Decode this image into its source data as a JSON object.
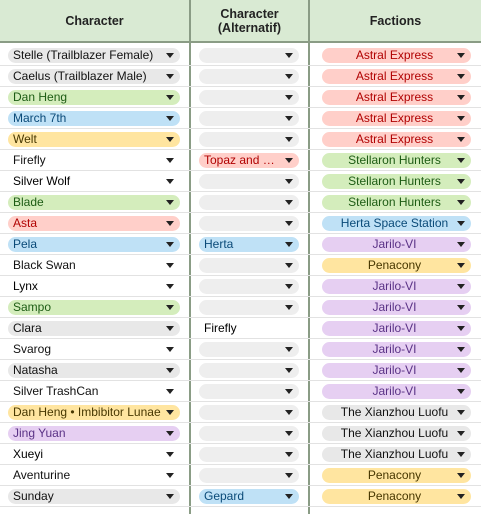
{
  "headers": {
    "character": "Character",
    "character_alt_line1": "Character",
    "character_alt_line2": "(Alternatif)",
    "factions": "Factions"
  },
  "colors": {
    "header_bg": "#d9ead3",
    "grey": "#e8e8e8",
    "green": "#d4edbc",
    "blue": "#bfe1f6",
    "yellow": "#ffe5a0",
    "red": "#ffcfc9",
    "purple": "#e6cff2",
    "lavender": "#d8d6fa"
  },
  "rows": [
    {
      "character": "Stelle (Trailblazer Female)",
      "char_color": "grey",
      "alt": "",
      "alt_color": "empty",
      "faction": "Astral Express",
      "faction_color": "red"
    },
    {
      "character": "Caelus (Trailblazer Male)",
      "char_color": "grey",
      "alt": "",
      "alt_color": "empty",
      "faction": "Astral Express",
      "faction_color": "red"
    },
    {
      "character": "Dan Heng",
      "char_color": "green",
      "alt": "",
      "alt_color": "empty",
      "faction": "Astral Express",
      "faction_color": "red"
    },
    {
      "character": "March 7th",
      "char_color": "blue",
      "alt": "",
      "alt_color": "empty",
      "faction": "Astral Express",
      "faction_color": "red"
    },
    {
      "character": "Welt",
      "char_color": "yellow",
      "alt": "",
      "alt_color": "empty",
      "faction": "Astral Express",
      "faction_color": "red"
    },
    {
      "character": "Firefly",
      "char_color": "white",
      "alt": "Topaz and Numby",
      "alt_color": "red",
      "faction": "Stellaron Hunters",
      "faction_color": "green"
    },
    {
      "character": "Silver Wolf",
      "char_color": "lavender",
      "alt": "",
      "alt_color": "empty",
      "faction": "Stellaron Hunters",
      "faction_color": "green"
    },
    {
      "character": "Blade",
      "char_color": "green",
      "alt": "",
      "alt_color": "empty",
      "faction": "Stellaron Hunters",
      "faction_color": "green"
    },
    {
      "character": "Asta",
      "char_color": "red",
      "alt": "",
      "alt_color": "empty",
      "faction": "Herta Space Station",
      "faction_color": "blue"
    },
    {
      "character": "Pela",
      "char_color": "blue",
      "alt": "Herta",
      "alt_color": "blue",
      "faction": "Jarilo-VI",
      "faction_color": "purple"
    },
    {
      "character": "Black Swan",
      "char_color": "white",
      "alt": "",
      "alt_color": "empty",
      "faction": "Penacony",
      "faction_color": "yellow"
    },
    {
      "character": "Lynx",
      "char_color": "lavender",
      "alt": "",
      "alt_color": "empty",
      "faction": "Jarilo-VI",
      "faction_color": "purple"
    },
    {
      "character": "Sampo",
      "char_color": "green",
      "alt": "",
      "alt_color": "empty",
      "faction": "Jarilo-VI",
      "faction_color": "purple"
    },
    {
      "character": "Clara",
      "char_color": "grey",
      "alt": "Firefly",
      "alt_color": "plain",
      "faction": "Jarilo-VI",
      "faction_color": "purple"
    },
    {
      "character": "Svarog",
      "char_color": "white",
      "alt": "",
      "alt_color": "empty",
      "faction": "Jarilo-VI",
      "faction_color": "purple"
    },
    {
      "character": "Natasha",
      "char_color": "grey",
      "alt": "",
      "alt_color": "empty",
      "faction": "Jarilo-VI",
      "faction_color": "purple"
    },
    {
      "character": "Silver TrashCan",
      "char_color": "white",
      "alt": "",
      "alt_color": "empty",
      "faction": "Jarilo-VI",
      "faction_color": "purple"
    },
    {
      "character": "Dan Heng • Imbibitor Lunae",
      "char_color": "yellow",
      "alt": "",
      "alt_color": "empty",
      "faction": "The Xianzhou Luofu",
      "faction_color": "grey"
    },
    {
      "character": "Jing Yuan",
      "char_color": "purple",
      "alt": "",
      "alt_color": "empty",
      "faction": "The Xianzhou Luofu",
      "faction_color": "grey"
    },
    {
      "character": "Xueyi",
      "char_color": "lavender",
      "alt": "",
      "alt_color": "empty",
      "faction": "The Xianzhou Luofu",
      "faction_color": "grey"
    },
    {
      "character": "Aventurine",
      "char_color": "white",
      "alt": "",
      "alt_color": "empty",
      "faction": "Penacony",
      "faction_color": "yellow"
    },
    {
      "character": "Sunday",
      "char_color": "grey",
      "alt": "Gepard",
      "alt_color": "blue",
      "faction": "Penacony",
      "faction_color": "yellow"
    }
  ]
}
